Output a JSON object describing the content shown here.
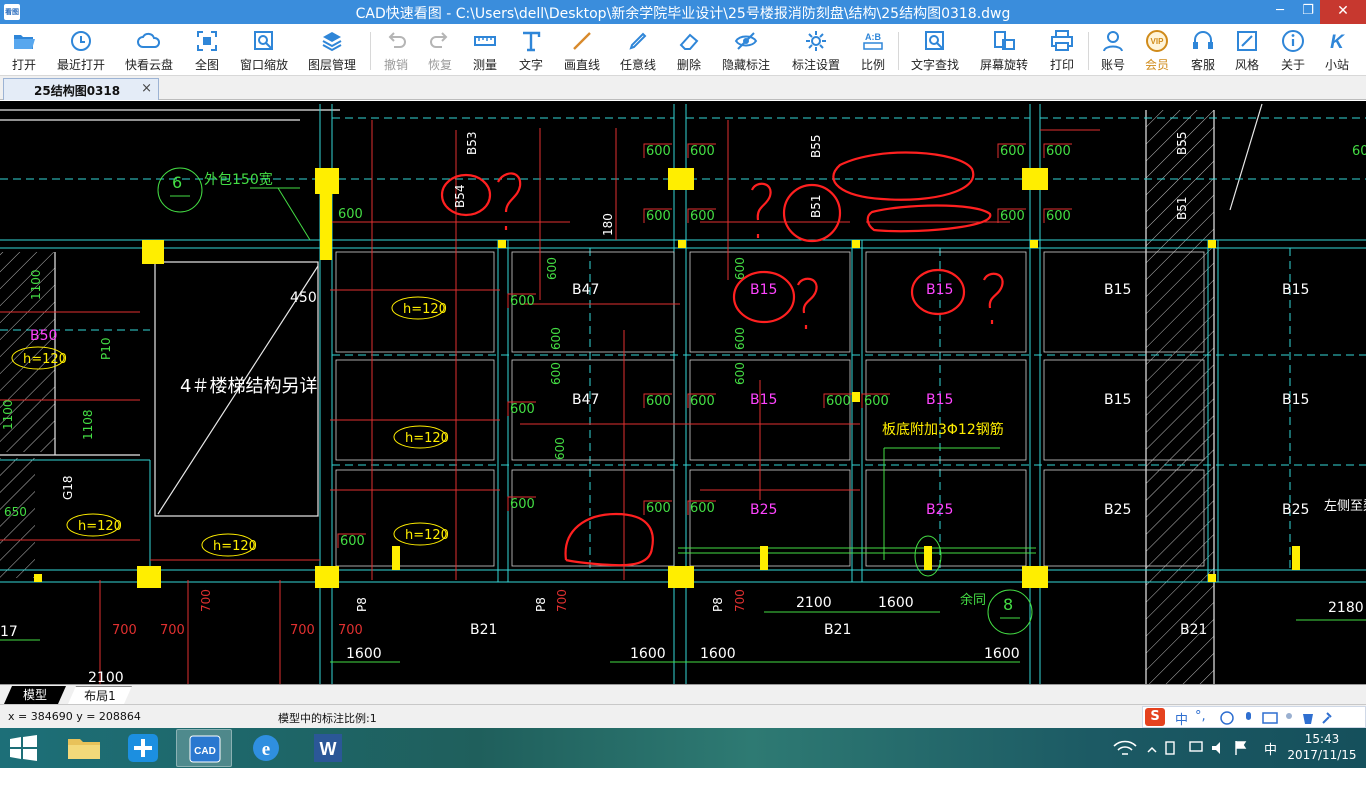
{
  "window": {
    "title": "CAD快速看图 - C:\\Users\\dell\\Desktop\\新余学院毕业设计\\25号楼报消防刻盘\\结构\\25结构图0318.dwg",
    "app_icon": "看图",
    "min": "─",
    "max": "❐",
    "close": "✕"
  },
  "toolbar": {
    "items": [
      {
        "label": "打开",
        "icon": "folder-open-icon"
      },
      {
        "label": "最近打开",
        "icon": "clock-icon"
      },
      {
        "label": "快看云盘",
        "icon": "cloud-icon"
      },
      {
        "label": "全图",
        "icon": "fit-all-icon"
      },
      {
        "label": "窗口缩放",
        "icon": "zoom-window-icon"
      },
      {
        "label": "图层管理",
        "icon": "layers-icon"
      },
      {
        "label": "撤销",
        "icon": "undo-icon",
        "disabled": true
      },
      {
        "label": "恢复",
        "icon": "redo-icon",
        "disabled": true
      },
      {
        "label": "测量",
        "icon": "ruler-icon"
      },
      {
        "label": "文字",
        "icon": "text-icon"
      },
      {
        "label": "画直线",
        "icon": "line-icon"
      },
      {
        "label": "任意线",
        "icon": "pen-icon"
      },
      {
        "label": "删除",
        "icon": "eraser-icon"
      },
      {
        "label": "隐藏标注",
        "icon": "eye-hide-icon"
      },
      {
        "label": "标注设置",
        "icon": "settings-icon"
      },
      {
        "label": "比例",
        "icon": "scale-icon",
        "badge": "A:B"
      },
      {
        "label": "文字查找",
        "icon": "text-search-icon"
      },
      {
        "label": "屏幕旋转",
        "icon": "rotate-screen-icon"
      },
      {
        "label": "打印",
        "icon": "printer-icon"
      },
      {
        "label": "账号",
        "icon": "user-icon"
      },
      {
        "label": "会员",
        "icon": "vip-icon",
        "badge": "VIP"
      },
      {
        "label": "客服",
        "icon": "headset-icon"
      },
      {
        "label": "风格",
        "icon": "style-icon"
      },
      {
        "label": "关于",
        "icon": "info-icon"
      },
      {
        "label": "小站",
        "icon": "site-icon",
        "badge": "K"
      }
    ]
  },
  "document_tab": {
    "label": "25结构图0318",
    "close": "×"
  },
  "drawing": {
    "labels_white": [
      "4＃楼梯结构另详",
      "B47",
      "B47",
      "B15",
      "B15",
      "B15",
      "B15",
      "B15",
      "B25",
      "B25",
      "B25",
      "B21",
      "B21",
      "B21",
      "B53",
      "B55",
      "B55",
      "B51",
      "B51",
      "B54",
      "左侧至梁中",
      "余同"
    ],
    "labels_magenta": [
      "B15",
      "B15",
      "B15",
      "B15",
      "B25",
      "B25",
      "B50"
    ],
    "labels_yellow": [
      "h=120",
      "h=120",
      "h=120",
      "h=120",
      "h=120",
      "h=120",
      "h=120"
    ],
    "labels_green": [
      "外包150宽",
      "板底附加3Φ12钢筋",
      "6",
      "8",
      "1600",
      "1600",
      "1600",
      "1600",
      "1600",
      "2100",
      "2100",
      "2180",
      "450",
      "180",
      "G18",
      "P10",
      "P10",
      "P8",
      "P8",
      "P8",
      "17",
      "1100",
      "1108",
      "650"
    ],
    "labels_red_dim": [
      "600",
      "700"
    ]
  },
  "layout_tabs": [
    {
      "label": "模型",
      "active": true
    },
    {
      "label": "布局1",
      "active": false
    }
  ],
  "status": {
    "coords": "x = 384690  y = 208864",
    "scale": "模型中的标注比例:1",
    "ime": {
      "logo": "S",
      "mode": "中",
      "punct": "°,"
    }
  },
  "taskbar": {
    "apps": [
      "file-explorer",
      "pinwheel-app",
      "cad-viewer",
      "internet-explorer",
      "word"
    ],
    "cad_label": "CAD",
    "tray_lang": "中",
    "time": "15:43",
    "date": "2017/11/15"
  }
}
